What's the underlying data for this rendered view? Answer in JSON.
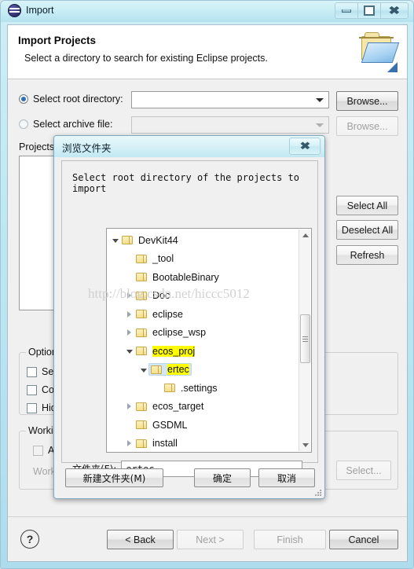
{
  "window": {
    "title": "Import",
    "icon": "eclipse-import-icon",
    "controls": {
      "minimize": "–",
      "maximize": "□",
      "close": "✕"
    }
  },
  "banner": {
    "title": "Import Projects",
    "subtitle": "Select a directory to search for existing Eclipse projects.",
    "icon": "open-folder-icon"
  },
  "form": {
    "root_directory": {
      "label": "Select root directory:",
      "selected": true,
      "value": "",
      "browse_label": "Browse..."
    },
    "archive_file": {
      "label": "Select archive file:",
      "selected": false,
      "enabled": false,
      "value": "",
      "browse_label": "Browse..."
    },
    "projects_label": "Projects:",
    "projects": [],
    "side_buttons": [
      {
        "label": "Select All",
        "enabled": true
      },
      {
        "label": "Deselect All",
        "enabled": true
      },
      {
        "label": "Refresh",
        "enabled": true
      }
    ],
    "options": {
      "title": "Options",
      "items": [
        {
          "label": "Sear",
          "checked": false
        },
        {
          "label": "Cop",
          "checked": false
        },
        {
          "label": "Hide",
          "checked": false
        }
      ]
    },
    "working_sets": {
      "title": "Workin",
      "add_label": "Add",
      "add_checked": false,
      "list_label": "Worki",
      "select_label": "Select..."
    }
  },
  "bottom": {
    "help": "?",
    "buttons": [
      {
        "label": "< Back",
        "enabled": true
      },
      {
        "label": "Next >",
        "enabled": false
      },
      {
        "label": "Finish",
        "enabled": false
      },
      {
        "label": "Cancel",
        "enabled": true
      }
    ]
  },
  "browse_dialog": {
    "title": "浏览文件夹",
    "close": "✕",
    "prompt": "Select root directory of the projects to import",
    "tree": [
      {
        "label": "DevKit44",
        "indent": 0,
        "expander": "open",
        "highlight": false,
        "selected": false
      },
      {
        "label": "_tool",
        "indent": 1,
        "expander": "none",
        "highlight": false,
        "selected": false
      },
      {
        "label": "BootableBinary",
        "indent": 1,
        "expander": "none",
        "highlight": false,
        "selected": false
      },
      {
        "label": "Doc",
        "indent": 1,
        "expander": "closed",
        "highlight": false,
        "selected": false
      },
      {
        "label": "eclipse",
        "indent": 1,
        "expander": "closed",
        "highlight": false,
        "selected": false
      },
      {
        "label": "eclipse_wsp",
        "indent": 1,
        "expander": "closed",
        "highlight": false,
        "selected": false
      },
      {
        "label": "ecos_proj",
        "indent": 1,
        "expander": "open",
        "highlight": true,
        "selected": false
      },
      {
        "label": "ertec",
        "indent": 2,
        "expander": "open",
        "highlight": true,
        "selected": true
      },
      {
        "label": ".settings",
        "indent": 3,
        "expander": "none",
        "highlight": false,
        "selected": false
      },
      {
        "label": "ecos_target",
        "indent": 1,
        "expander": "closed",
        "highlight": false,
        "selected": false
      },
      {
        "label": "GSDML",
        "indent": 1,
        "expander": "none",
        "highlight": false,
        "selected": false
      },
      {
        "label": "install",
        "indent": 1,
        "expander": "closed",
        "highlight": false,
        "selected": false
      },
      {
        "label": "",
        "indent": 1,
        "expander": "none",
        "highlight": false,
        "selected": false
      }
    ],
    "folder_field": {
      "label": "文件夹(F):",
      "value": "ertec"
    },
    "buttons": {
      "new_folder": "新建文件夹(M)",
      "ok": "确定",
      "cancel": "取消"
    }
  },
  "watermark": "http://blog.csdn.net/hiccc5012"
}
